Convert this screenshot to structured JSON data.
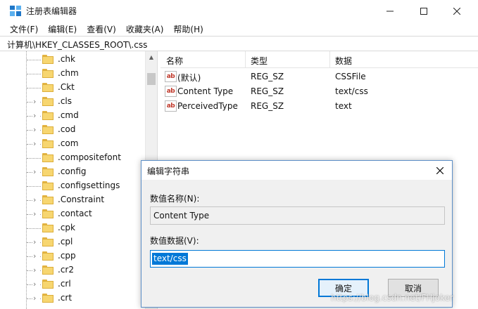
{
  "window": {
    "title": "注册表编辑器",
    "icon": "regedit-icon"
  },
  "menu": [
    "文件(F)",
    "编辑(E)",
    "查看(V)",
    "收藏夹(A)",
    "帮助(H)"
  ],
  "address": "计算机\\HKEY_CLASSES_ROOT\\.css",
  "tree": {
    "items": [
      {
        "label": ".chk",
        "expandable": false
      },
      {
        "label": ".chm",
        "expandable": false
      },
      {
        "label": ".Ckt",
        "expandable": false
      },
      {
        "label": ".cls",
        "expandable": true
      },
      {
        "label": ".cmd",
        "expandable": true
      },
      {
        "label": ".cod",
        "expandable": true
      },
      {
        "label": ".com",
        "expandable": true
      },
      {
        "label": ".compositefont",
        "expandable": false
      },
      {
        "label": ".config",
        "expandable": true
      },
      {
        "label": ".configsettings",
        "expandable": false
      },
      {
        "label": ".Constraint",
        "expandable": true
      },
      {
        "label": ".contact",
        "expandable": true
      },
      {
        "label": ".cpk",
        "expandable": false
      },
      {
        "label": ".cpl",
        "expandable": true
      },
      {
        "label": ".cpp",
        "expandable": true
      },
      {
        "label": ".cr2",
        "expandable": true
      },
      {
        "label": ".crl",
        "expandable": true
      },
      {
        "label": ".crt",
        "expandable": true
      }
    ]
  },
  "list": {
    "columns": [
      "名称",
      "类型",
      "数据"
    ],
    "rows": [
      {
        "name": "(默认)",
        "type": "REG_SZ",
        "data": "CSSFile"
      },
      {
        "name": "Content Type",
        "type": "REG_SZ",
        "data": "text/css"
      },
      {
        "name": "PerceivedType",
        "type": "REG_SZ",
        "data": "text"
      }
    ]
  },
  "dialog": {
    "title": "编辑字符串",
    "name_label": "数值名称(N):",
    "name_value": "Content Type",
    "data_label": "数值数据(V):",
    "data_value": "text/css",
    "ok_label": "确定",
    "cancel_label": "取消"
  },
  "watermark": "https://blog.csdn.net/FHjoker",
  "colors": {
    "accent": "#0078d7",
    "folder": "#f7d670"
  }
}
